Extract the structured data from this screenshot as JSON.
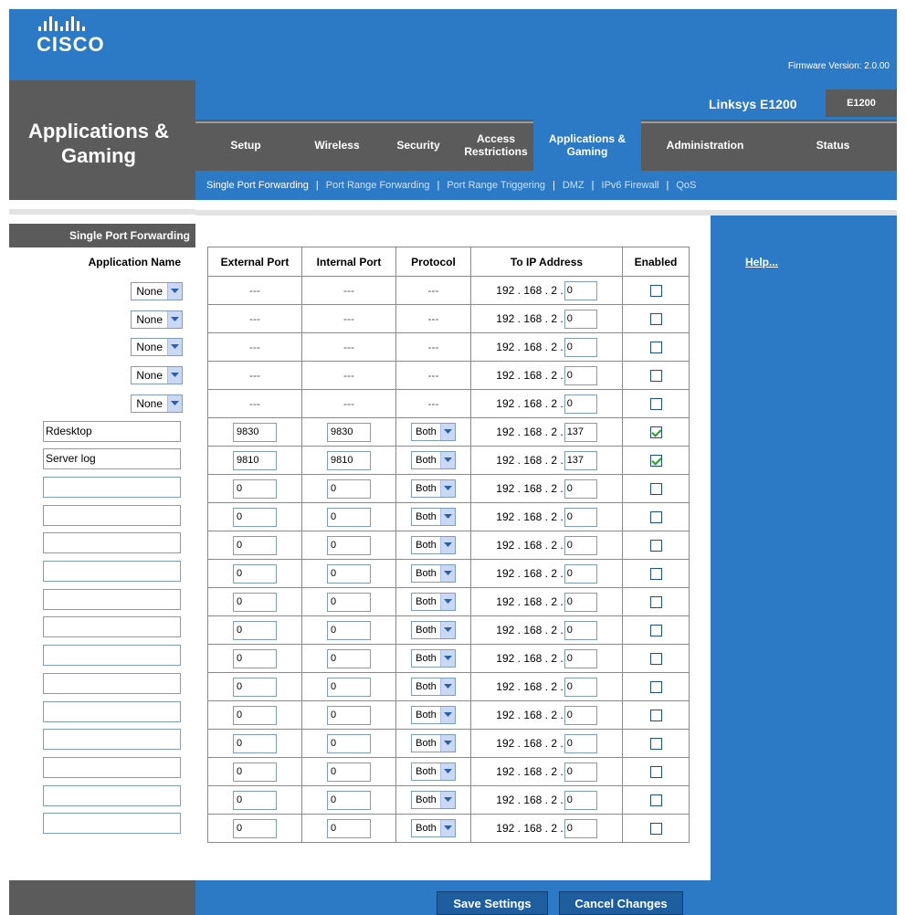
{
  "header": {
    "logo_text": "CISCO",
    "firmware": "Firmware Version: 2.0.00"
  },
  "section": {
    "title": "Applications & Gaming"
  },
  "model": {
    "name": "Linksys E1200",
    "code": "E1200"
  },
  "tabs": [
    {
      "label": "Setup",
      "active": false
    },
    {
      "label": "Wireless",
      "active": false
    },
    {
      "label": "Security",
      "active": false
    },
    {
      "label": "Access Restrictions",
      "active": false
    },
    {
      "label": "Applications & Gaming",
      "active": true
    },
    {
      "label": "Administration",
      "active": false
    },
    {
      "label": "Status",
      "active": false
    }
  ],
  "subnav": [
    {
      "label": "Single Port Forwarding",
      "active": true
    },
    {
      "label": "Port Range Forwarding",
      "active": false
    },
    {
      "label": "Port Range Triggering",
      "active": false
    },
    {
      "label": "DMZ",
      "active": false
    },
    {
      "label": "IPv6 Firewall",
      "active": false
    },
    {
      "label": "QoS",
      "active": false
    }
  ],
  "page": {
    "heading": "Single Port Forwarding",
    "help_link": "Help...",
    "ip_prefix": "192 . 168 . 2 ."
  },
  "table": {
    "headers": {
      "app_name": "Application Name",
      "external_port": "External Port",
      "internal_port": "Internal Port",
      "protocol": "Protocol",
      "to_ip": "To IP Address",
      "enabled": "Enabled"
    },
    "rows": [
      {
        "type": "preset",
        "app": "None",
        "ext": "---",
        "int": "---",
        "proto": "---",
        "ip_last": "0",
        "enabled": false
      },
      {
        "type": "preset",
        "app": "None",
        "ext": "---",
        "int": "---",
        "proto": "---",
        "ip_last": "0",
        "enabled": false
      },
      {
        "type": "preset",
        "app": "None",
        "ext": "---",
        "int": "---",
        "proto": "---",
        "ip_last": "0",
        "enabled": false
      },
      {
        "type": "preset",
        "app": "None",
        "ext": "---",
        "int": "---",
        "proto": "---",
        "ip_last": "0",
        "enabled": false
      },
      {
        "type": "preset",
        "app": "None",
        "ext": "---",
        "int": "---",
        "proto": "---",
        "ip_last": "0",
        "enabled": false
      },
      {
        "type": "custom",
        "app": "Rdesktop",
        "ext": "9830",
        "int": "9830",
        "proto": "Both",
        "ip_last": "137",
        "enabled": true
      },
      {
        "type": "custom",
        "app": "Server log",
        "ext": "9810",
        "int": "9810",
        "proto": "Both",
        "ip_last": "137",
        "enabled": true
      },
      {
        "type": "custom",
        "app": "",
        "ext": "0",
        "int": "0",
        "proto": "Both",
        "ip_last": "0",
        "enabled": false
      },
      {
        "type": "custom",
        "app": "",
        "ext": "0",
        "int": "0",
        "proto": "Both",
        "ip_last": "0",
        "enabled": false
      },
      {
        "type": "custom",
        "app": "",
        "ext": "0",
        "int": "0",
        "proto": "Both",
        "ip_last": "0",
        "enabled": false
      },
      {
        "type": "custom",
        "app": "",
        "ext": "0",
        "int": "0",
        "proto": "Both",
        "ip_last": "0",
        "enabled": false
      },
      {
        "type": "custom",
        "app": "",
        "ext": "0",
        "int": "0",
        "proto": "Both",
        "ip_last": "0",
        "enabled": false
      },
      {
        "type": "custom",
        "app": "",
        "ext": "0",
        "int": "0",
        "proto": "Both",
        "ip_last": "0",
        "enabled": false
      },
      {
        "type": "custom",
        "app": "",
        "ext": "0",
        "int": "0",
        "proto": "Both",
        "ip_last": "0",
        "enabled": false
      },
      {
        "type": "custom",
        "app": "",
        "ext": "0",
        "int": "0",
        "proto": "Both",
        "ip_last": "0",
        "enabled": false
      },
      {
        "type": "custom",
        "app": "",
        "ext": "0",
        "int": "0",
        "proto": "Both",
        "ip_last": "0",
        "enabled": false
      },
      {
        "type": "custom",
        "app": "",
        "ext": "0",
        "int": "0",
        "proto": "Both",
        "ip_last": "0",
        "enabled": false
      },
      {
        "type": "custom",
        "app": "",
        "ext": "0",
        "int": "0",
        "proto": "Both",
        "ip_last": "0",
        "enabled": false
      },
      {
        "type": "custom",
        "app": "",
        "ext": "0",
        "int": "0",
        "proto": "Both",
        "ip_last": "0",
        "enabled": false
      },
      {
        "type": "custom",
        "app": "",
        "ext": "0",
        "int": "0",
        "proto": "Both",
        "ip_last": "0",
        "enabled": false
      }
    ]
  },
  "buttons": {
    "save": "Save Settings",
    "cancel": "Cancel Changes"
  },
  "colors": {
    "brand_blue": "#2c7ac6",
    "dark_gray": "#5b5b5b",
    "separator_gray": "#e2e2e2"
  }
}
